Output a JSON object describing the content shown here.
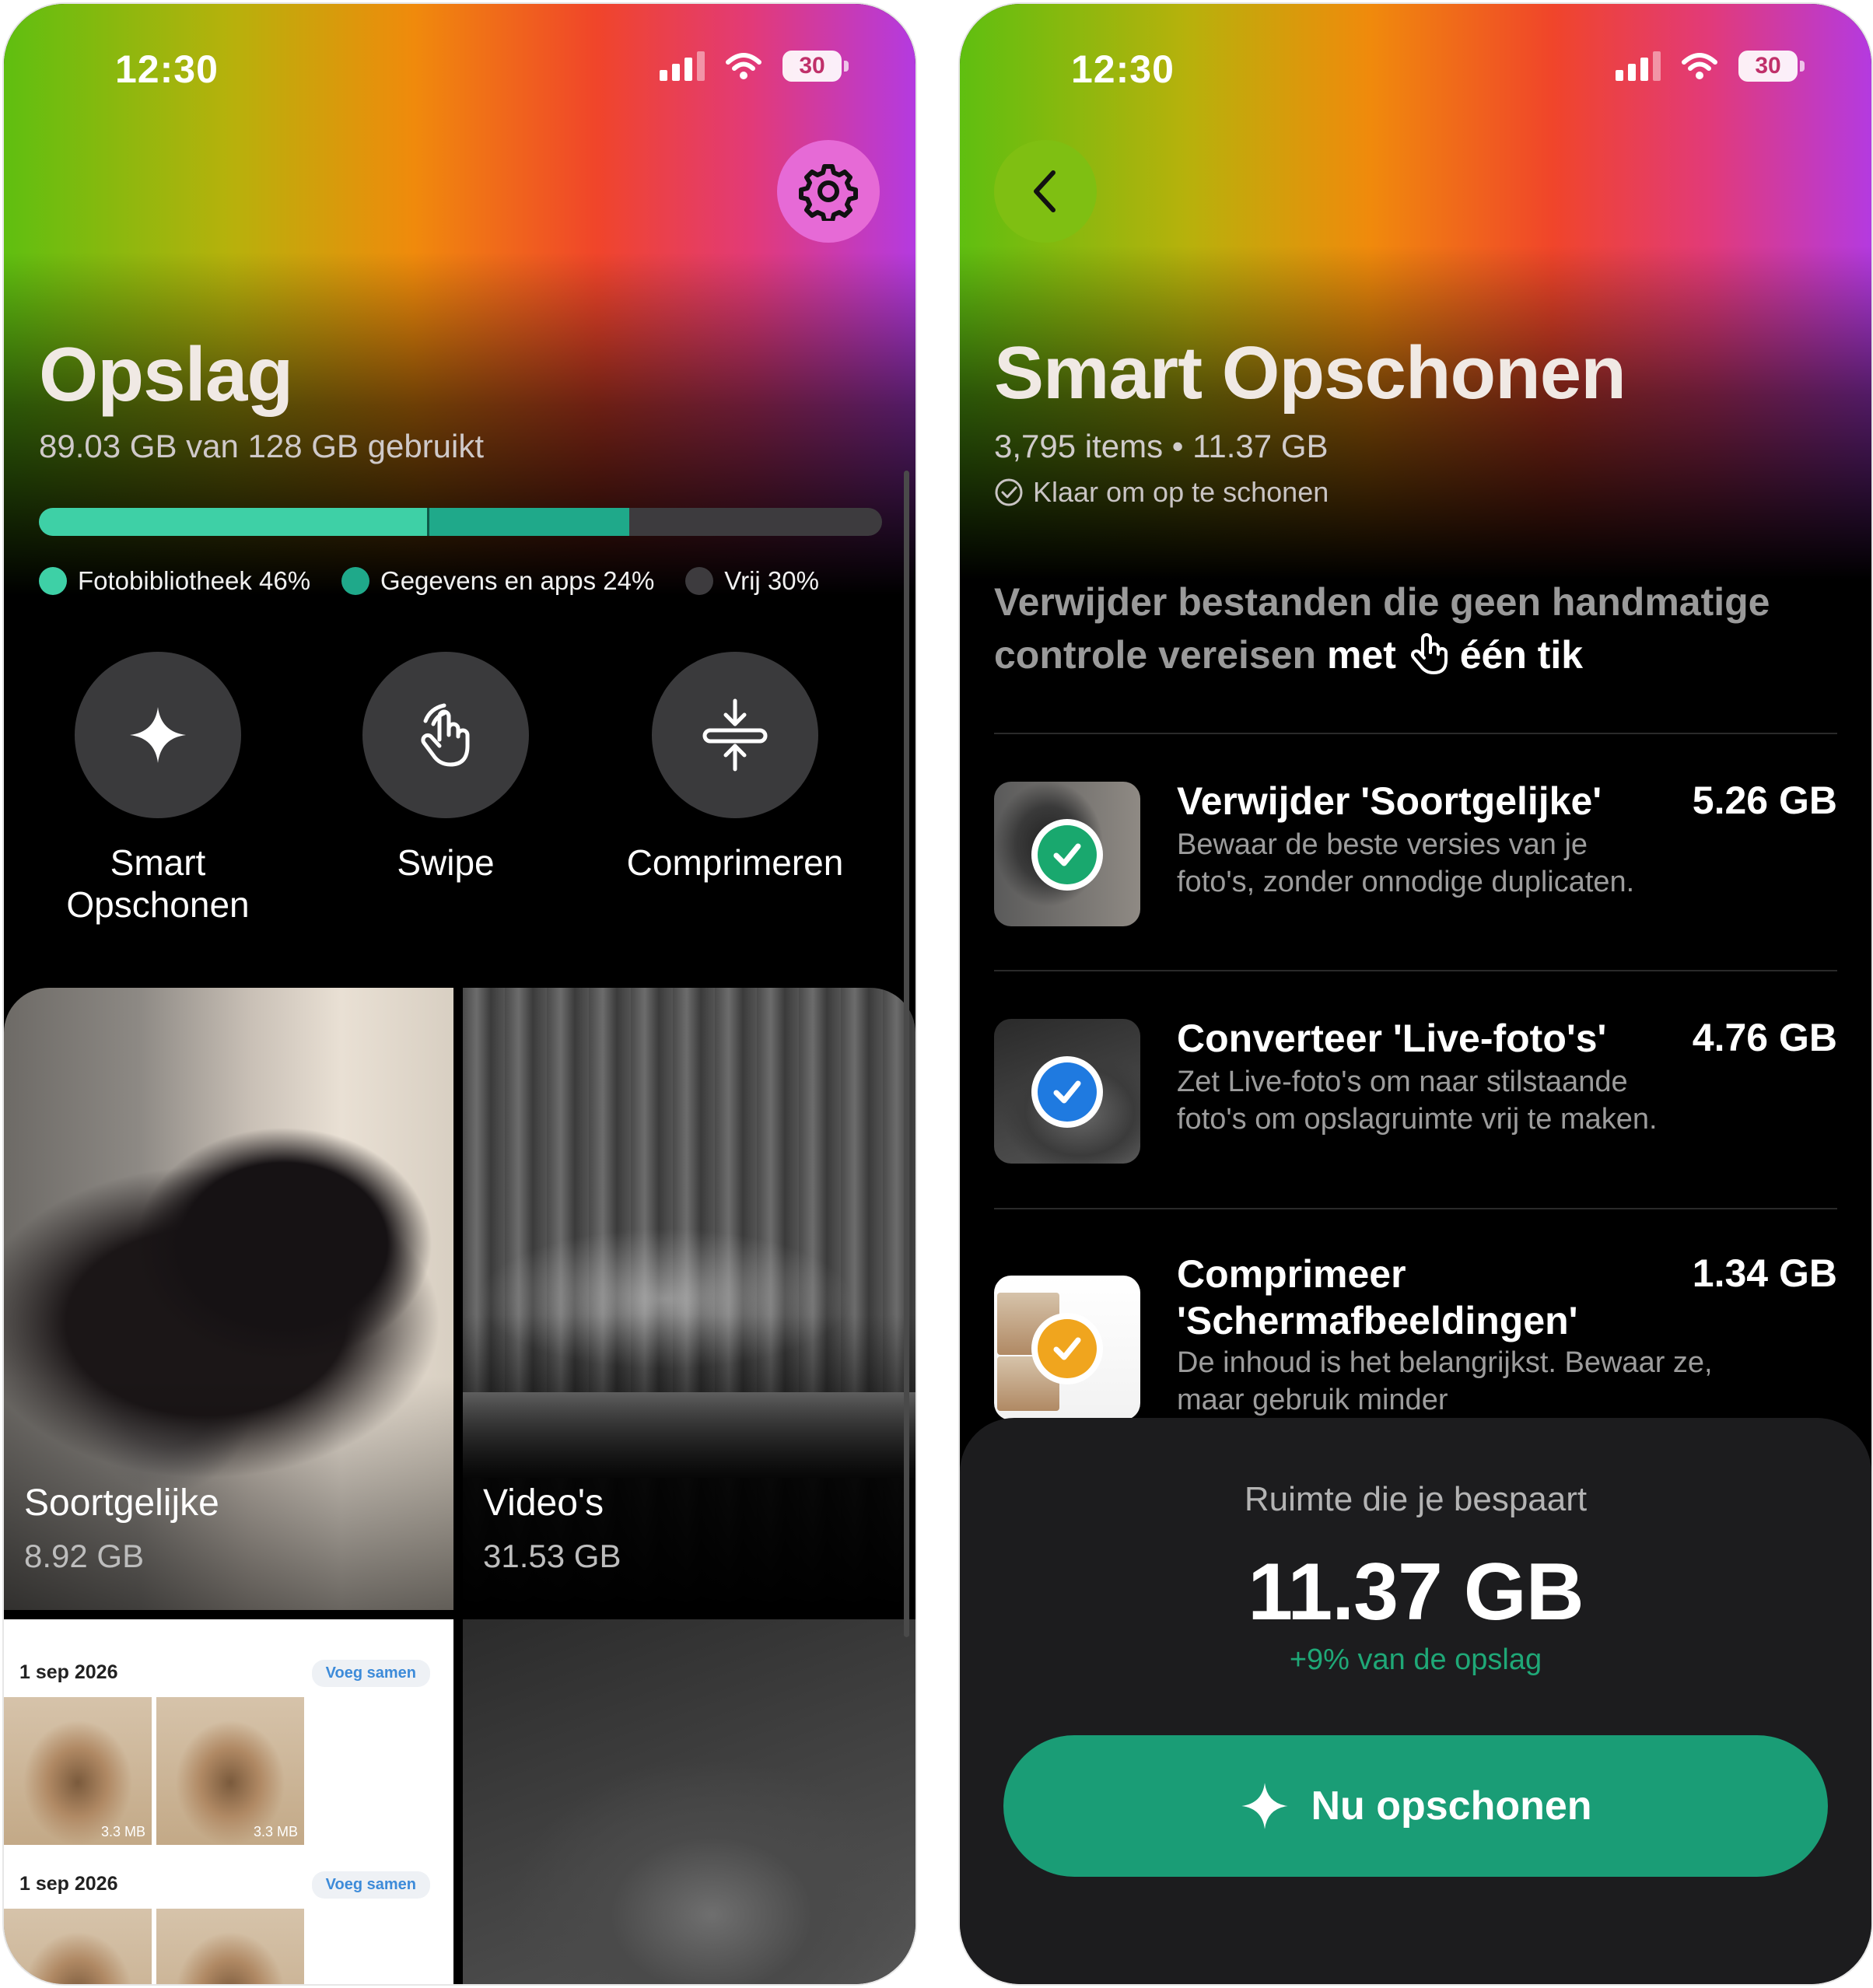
{
  "status": {
    "time": "12:30",
    "battery": "30"
  },
  "left": {
    "title": "Opslag",
    "subtitle": "89.03 GB van 128 GB gebruikt",
    "storage": {
      "photo_fraction": 0.46,
      "apps_fraction": 0.24
    },
    "legend": [
      {
        "label": "Fotobibliotheek 46%",
        "color": "#3ed0a6"
      },
      {
        "label": "Gegevens en apps 24%",
        "color": "#1fa98a"
      },
      {
        "label": "Vrij 30%",
        "color": "#3d3b3e"
      }
    ],
    "actions": [
      {
        "label": "Smart Opschonen",
        "icon": "sparkle-icon"
      },
      {
        "label": "Swipe",
        "icon": "hand-swipe-icon"
      },
      {
        "label": "Comprimeren",
        "icon": "compress-icon"
      }
    ],
    "tiles": {
      "similar": {
        "title": "Soortgelijke",
        "size": "8.92 GB"
      },
      "videos": {
        "title": "Video's",
        "size": "31.53 GB"
      },
      "screenshots": {
        "rows": [
          {
            "date": "1 sep 2026",
            "merge": "Voeg samen",
            "sizes": [
              "3.3 MB",
              "3.3 MB"
            ]
          },
          {
            "date": "1 sep 2026",
            "merge": "Voeg samen",
            "sizes": [
              "",
              ""
            ]
          }
        ]
      }
    }
  },
  "right": {
    "title": "Smart Opschonen",
    "subtitle": "3,795 items • 11.37 GB",
    "ready": "Klaar om op te schonen",
    "intro": {
      "muted": "Verwijder bestanden die geen handmatige controle vereisen",
      "em1": "met",
      "em2": "één tik"
    },
    "items": [
      {
        "title": "Verwijder 'Soortgelijke'",
        "size": "5.26 GB",
        "desc": "Bewaar de beste versies van je foto's, zonder onnodige duplicaten.",
        "check_color": "#19a86e"
      },
      {
        "title": "Converteer 'Live-foto's'",
        "size": "4.76 GB",
        "desc": "Zet Live-foto's om naar stilstaande foto's om opslagruimte vrij te maken.",
        "check_color": "#1f7ae0"
      },
      {
        "title": "Comprimeer 'Schermafbeeldingen'",
        "size": "1.34 GB",
        "desc": "De inhoud is het belangrijkst. Bewaar ze, maar gebruik minder",
        "check_color": "#f0a51e"
      }
    ],
    "summary": {
      "label": "Ruimte die je bespaart",
      "value": "11.37 GB",
      "percent": "+9% van de opslag",
      "cta": "Nu opschonen"
    }
  }
}
